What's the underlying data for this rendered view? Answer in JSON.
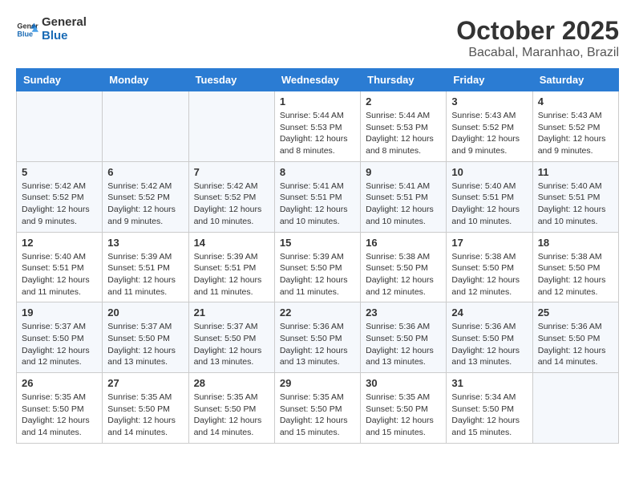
{
  "logo": {
    "text_general": "General",
    "text_blue": "Blue"
  },
  "title": "October 2025",
  "location": "Bacabal, Maranhao, Brazil",
  "days_of_week": [
    "Sunday",
    "Monday",
    "Tuesday",
    "Wednesday",
    "Thursday",
    "Friday",
    "Saturday"
  ],
  "weeks": [
    [
      {
        "day": "",
        "content": ""
      },
      {
        "day": "",
        "content": ""
      },
      {
        "day": "",
        "content": ""
      },
      {
        "day": "1",
        "content": "Sunrise: 5:44 AM\nSunset: 5:53 PM\nDaylight: 12 hours and 8 minutes."
      },
      {
        "day": "2",
        "content": "Sunrise: 5:44 AM\nSunset: 5:53 PM\nDaylight: 12 hours and 8 minutes."
      },
      {
        "day": "3",
        "content": "Sunrise: 5:43 AM\nSunset: 5:52 PM\nDaylight: 12 hours and 9 minutes."
      },
      {
        "day": "4",
        "content": "Sunrise: 5:43 AM\nSunset: 5:52 PM\nDaylight: 12 hours and 9 minutes."
      }
    ],
    [
      {
        "day": "5",
        "content": "Sunrise: 5:42 AM\nSunset: 5:52 PM\nDaylight: 12 hours and 9 minutes."
      },
      {
        "day": "6",
        "content": "Sunrise: 5:42 AM\nSunset: 5:52 PM\nDaylight: 12 hours and 9 minutes."
      },
      {
        "day": "7",
        "content": "Sunrise: 5:42 AM\nSunset: 5:52 PM\nDaylight: 12 hours and 10 minutes."
      },
      {
        "day": "8",
        "content": "Sunrise: 5:41 AM\nSunset: 5:51 PM\nDaylight: 12 hours and 10 minutes."
      },
      {
        "day": "9",
        "content": "Sunrise: 5:41 AM\nSunset: 5:51 PM\nDaylight: 12 hours and 10 minutes."
      },
      {
        "day": "10",
        "content": "Sunrise: 5:40 AM\nSunset: 5:51 PM\nDaylight: 12 hours and 10 minutes."
      },
      {
        "day": "11",
        "content": "Sunrise: 5:40 AM\nSunset: 5:51 PM\nDaylight: 12 hours and 10 minutes."
      }
    ],
    [
      {
        "day": "12",
        "content": "Sunrise: 5:40 AM\nSunset: 5:51 PM\nDaylight: 12 hours and 11 minutes."
      },
      {
        "day": "13",
        "content": "Sunrise: 5:39 AM\nSunset: 5:51 PM\nDaylight: 12 hours and 11 minutes."
      },
      {
        "day": "14",
        "content": "Sunrise: 5:39 AM\nSunset: 5:51 PM\nDaylight: 12 hours and 11 minutes."
      },
      {
        "day": "15",
        "content": "Sunrise: 5:39 AM\nSunset: 5:50 PM\nDaylight: 12 hours and 11 minutes."
      },
      {
        "day": "16",
        "content": "Sunrise: 5:38 AM\nSunset: 5:50 PM\nDaylight: 12 hours and 12 minutes."
      },
      {
        "day": "17",
        "content": "Sunrise: 5:38 AM\nSunset: 5:50 PM\nDaylight: 12 hours and 12 minutes."
      },
      {
        "day": "18",
        "content": "Sunrise: 5:38 AM\nSunset: 5:50 PM\nDaylight: 12 hours and 12 minutes."
      }
    ],
    [
      {
        "day": "19",
        "content": "Sunrise: 5:37 AM\nSunset: 5:50 PM\nDaylight: 12 hours and 12 minutes."
      },
      {
        "day": "20",
        "content": "Sunrise: 5:37 AM\nSunset: 5:50 PM\nDaylight: 12 hours and 13 minutes."
      },
      {
        "day": "21",
        "content": "Sunrise: 5:37 AM\nSunset: 5:50 PM\nDaylight: 12 hours and 13 minutes."
      },
      {
        "day": "22",
        "content": "Sunrise: 5:36 AM\nSunset: 5:50 PM\nDaylight: 12 hours and 13 minutes."
      },
      {
        "day": "23",
        "content": "Sunrise: 5:36 AM\nSunset: 5:50 PM\nDaylight: 12 hours and 13 minutes."
      },
      {
        "day": "24",
        "content": "Sunrise: 5:36 AM\nSunset: 5:50 PM\nDaylight: 12 hours and 13 minutes."
      },
      {
        "day": "25",
        "content": "Sunrise: 5:36 AM\nSunset: 5:50 PM\nDaylight: 12 hours and 14 minutes."
      }
    ],
    [
      {
        "day": "26",
        "content": "Sunrise: 5:35 AM\nSunset: 5:50 PM\nDaylight: 12 hours and 14 minutes."
      },
      {
        "day": "27",
        "content": "Sunrise: 5:35 AM\nSunset: 5:50 PM\nDaylight: 12 hours and 14 minutes."
      },
      {
        "day": "28",
        "content": "Sunrise: 5:35 AM\nSunset: 5:50 PM\nDaylight: 12 hours and 14 minutes."
      },
      {
        "day": "29",
        "content": "Sunrise: 5:35 AM\nSunset: 5:50 PM\nDaylight: 12 hours and 15 minutes."
      },
      {
        "day": "30",
        "content": "Sunrise: 5:35 AM\nSunset: 5:50 PM\nDaylight: 12 hours and 15 minutes."
      },
      {
        "day": "31",
        "content": "Sunrise: 5:34 AM\nSunset: 5:50 PM\nDaylight: 12 hours and 15 minutes."
      },
      {
        "day": "",
        "content": ""
      }
    ]
  ]
}
